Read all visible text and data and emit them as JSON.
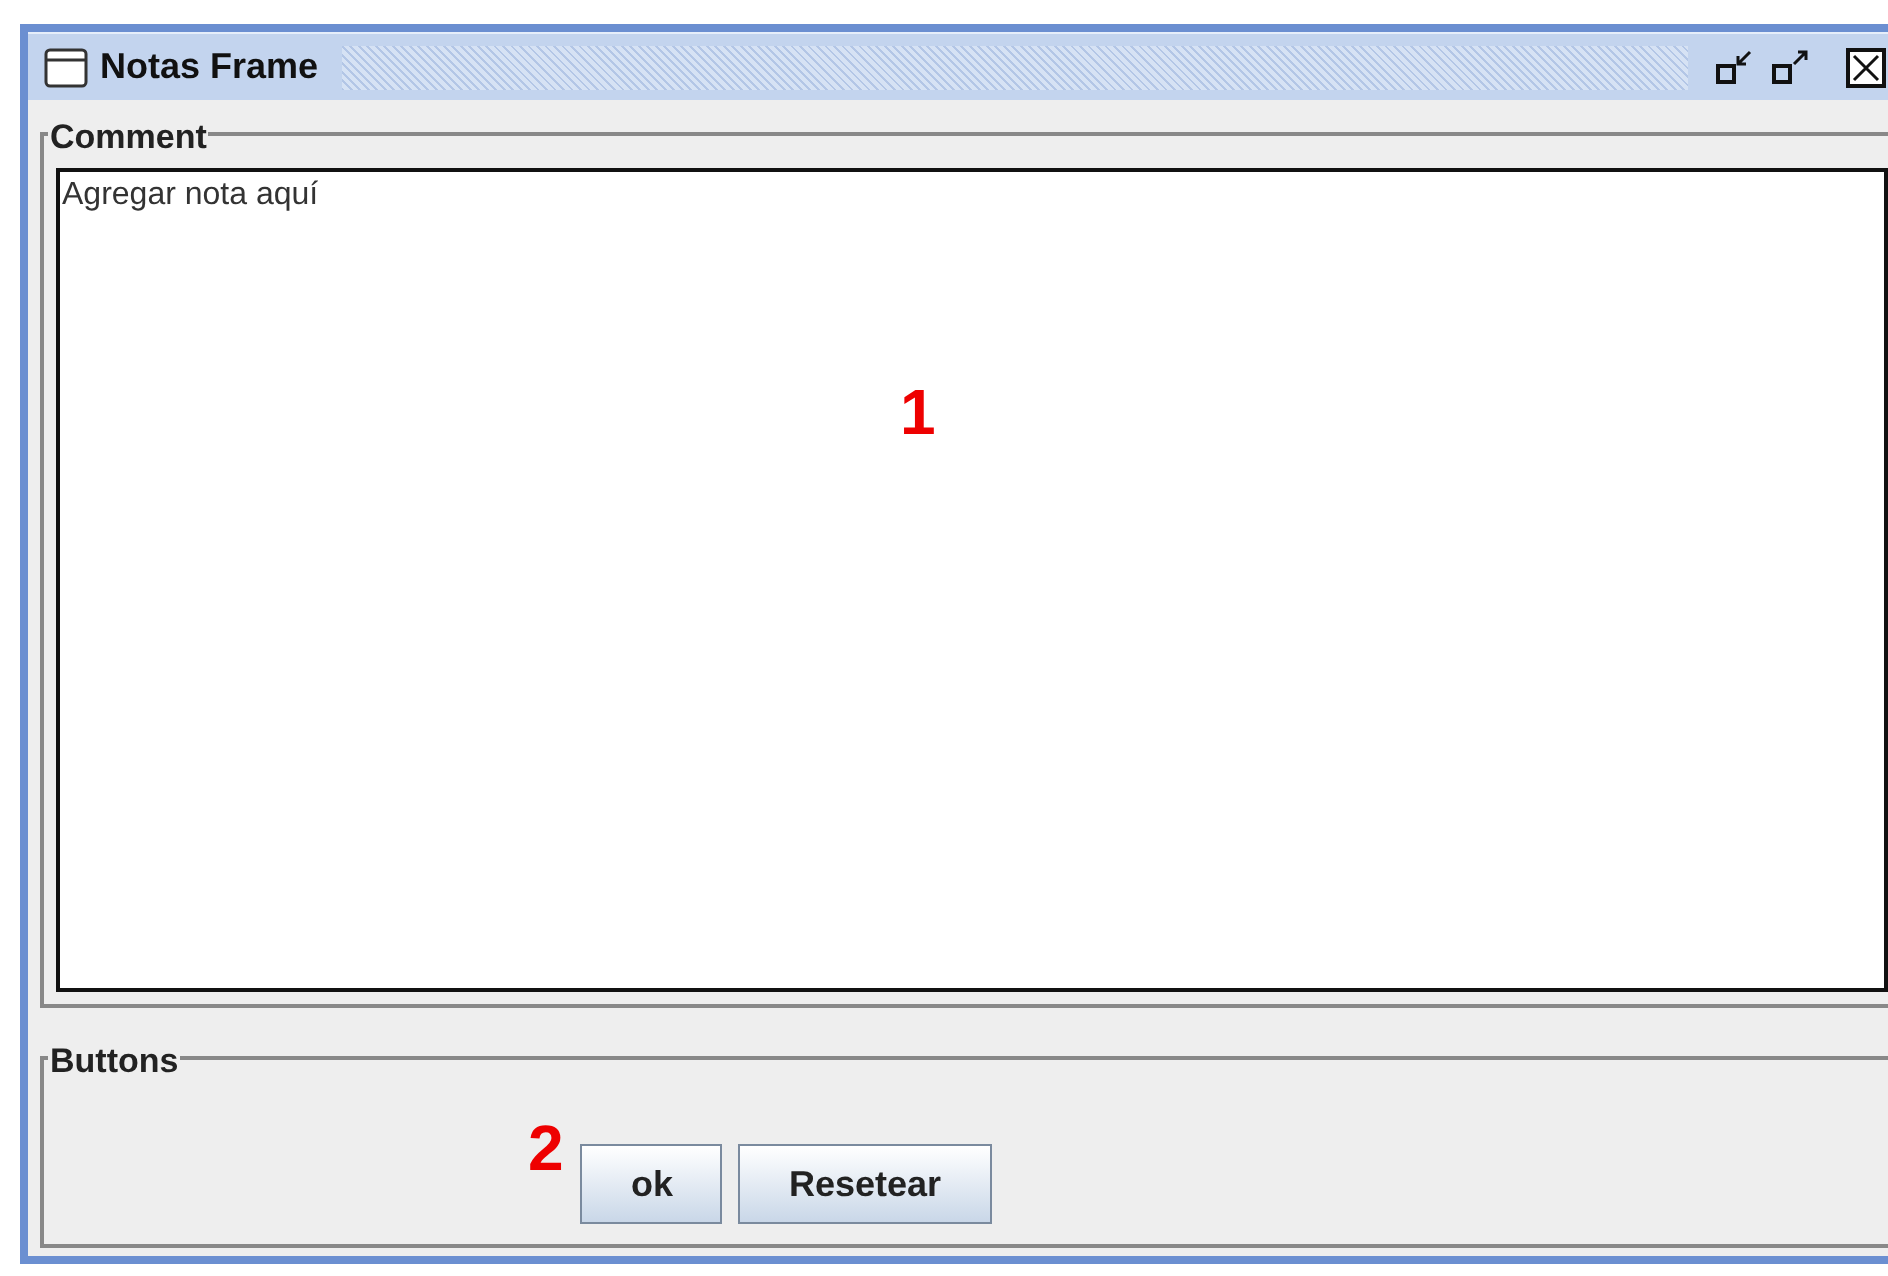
{
  "window": {
    "title": "Notas Frame"
  },
  "comment_group": {
    "title": "Comment",
    "field_value": "Agregar nota aquí",
    "marker": "1"
  },
  "buttons_group": {
    "title": "Buttons",
    "marker": "2",
    "buttons": [
      {
        "label": "ok"
      },
      {
        "label": "Resetear"
      }
    ]
  }
}
